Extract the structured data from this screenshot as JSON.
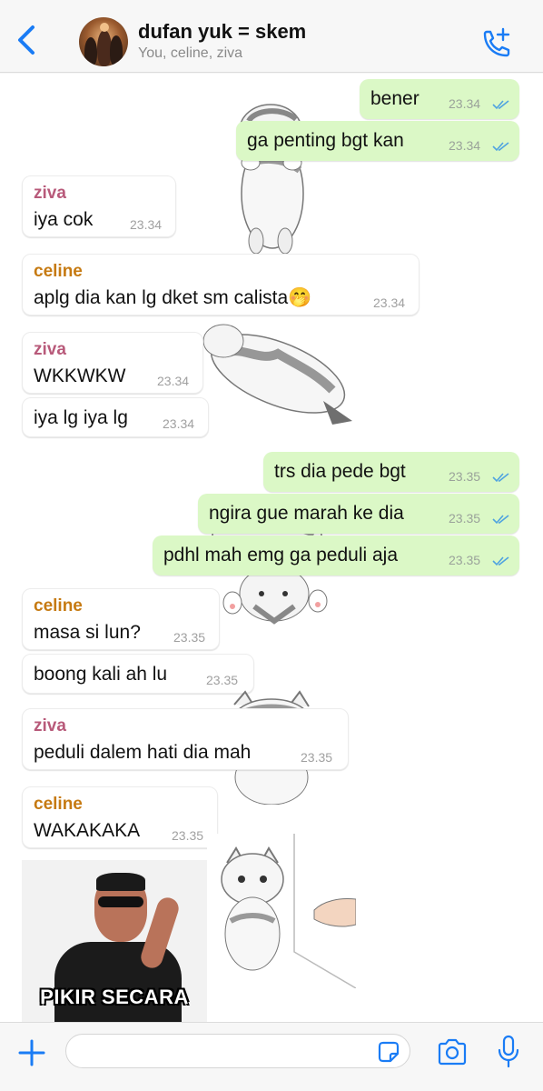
{
  "header": {
    "back_icon": "chevron-left-icon",
    "title": "dufan yuk = skem",
    "subtitle": "You, celine, ziva",
    "call_icon": "phone-plus-icon",
    "accent": "#1a7cf5"
  },
  "messages": {
    "m1": {
      "text": "bener",
      "time": "23.34",
      "read": true
    },
    "m2": {
      "text": "ga penting bgt kan",
      "time": "23.34",
      "read": true
    },
    "m3": {
      "sender": "ziva",
      "text": "iya cok",
      "time": "23.34"
    },
    "m4": {
      "sender": "celine",
      "text": "aplg dia kan lg dket sm calista",
      "emoji": "🤭",
      "time": "23.34"
    },
    "m5": {
      "sender": "ziva",
      "text": "WKKWKW",
      "time": "23.34"
    },
    "m6": {
      "text": "iya lg iya lg",
      "time": "23.34"
    },
    "m7": {
      "text": "trs dia pede bgt",
      "time": "23.35",
      "read": true
    },
    "m8": {
      "text": "ngira gue marah ke dia",
      "time": "23.35",
      "read": true
    },
    "m9": {
      "text": "pdhl mah emg ga peduli aja",
      "time": "23.35",
      "read": true
    },
    "m10": {
      "sender": "celine",
      "text": "masa si lun?",
      "time": "23.35"
    },
    "m11": {
      "text": "boong kali ah lu",
      "time": "23.35"
    },
    "m12": {
      "sender": "ziva",
      "text": "peduli dalem hati dia mah",
      "time": "23.35"
    },
    "m13": {
      "sender": "celine",
      "text": "WAKAKAKA",
      "time": "23.35"
    }
  },
  "meme": {
    "caption": "PIKIR SECARA"
  },
  "colors": {
    "outgoing_bubble": "#dbf8c6",
    "incoming_bubble": "#ffffff",
    "ziva_name": "#b85a7a",
    "celine_name": "#c67a12",
    "read_ticks": "#4fa3e0"
  },
  "input_bar": {
    "plus_icon": "plus-icon",
    "sticker_icon": "sticker-icon",
    "camera_icon": "camera-icon",
    "mic_icon": "microphone-icon",
    "placeholder": ""
  }
}
